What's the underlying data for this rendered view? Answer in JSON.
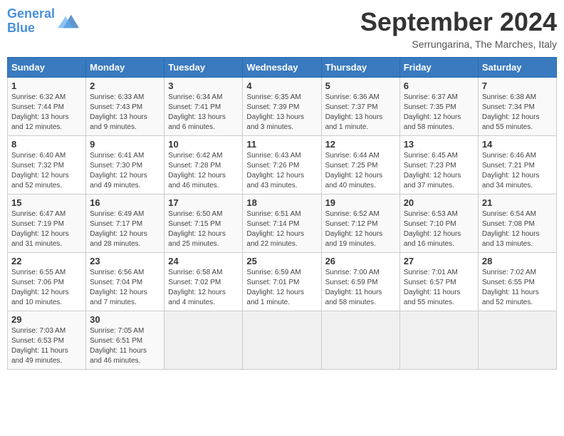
{
  "header": {
    "logo_line1": "General",
    "logo_line2": "Blue",
    "title": "September 2024",
    "location": "Serrungarina, The Marches, Italy"
  },
  "days_of_week": [
    "Sunday",
    "Monday",
    "Tuesday",
    "Wednesday",
    "Thursday",
    "Friday",
    "Saturday"
  ],
  "weeks": [
    [
      {
        "day": "1",
        "sunrise": "6:32 AM",
        "sunset": "7:44 PM",
        "daylight": "13 hours and 12 minutes."
      },
      {
        "day": "2",
        "sunrise": "6:33 AM",
        "sunset": "7:43 PM",
        "daylight": "13 hours and 9 minutes."
      },
      {
        "day": "3",
        "sunrise": "6:34 AM",
        "sunset": "7:41 PM",
        "daylight": "13 hours and 6 minutes."
      },
      {
        "day": "4",
        "sunrise": "6:35 AM",
        "sunset": "7:39 PM",
        "daylight": "13 hours and 3 minutes."
      },
      {
        "day": "5",
        "sunrise": "6:36 AM",
        "sunset": "7:37 PM",
        "daylight": "13 hours and 1 minute."
      },
      {
        "day": "6",
        "sunrise": "6:37 AM",
        "sunset": "7:35 PM",
        "daylight": "12 hours and 58 minutes."
      },
      {
        "day": "7",
        "sunrise": "6:38 AM",
        "sunset": "7:34 PM",
        "daylight": "12 hours and 55 minutes."
      }
    ],
    [
      {
        "day": "8",
        "sunrise": "6:40 AM",
        "sunset": "7:32 PM",
        "daylight": "12 hours and 52 minutes."
      },
      {
        "day": "9",
        "sunrise": "6:41 AM",
        "sunset": "7:30 PM",
        "daylight": "12 hours and 49 minutes."
      },
      {
        "day": "10",
        "sunrise": "6:42 AM",
        "sunset": "7:28 PM",
        "daylight": "12 hours and 46 minutes."
      },
      {
        "day": "11",
        "sunrise": "6:43 AM",
        "sunset": "7:26 PM",
        "daylight": "12 hours and 43 minutes."
      },
      {
        "day": "12",
        "sunrise": "6:44 AM",
        "sunset": "7:25 PM",
        "daylight": "12 hours and 40 minutes."
      },
      {
        "day": "13",
        "sunrise": "6:45 AM",
        "sunset": "7:23 PM",
        "daylight": "12 hours and 37 minutes."
      },
      {
        "day": "14",
        "sunrise": "6:46 AM",
        "sunset": "7:21 PM",
        "daylight": "12 hours and 34 minutes."
      }
    ],
    [
      {
        "day": "15",
        "sunrise": "6:47 AM",
        "sunset": "7:19 PM",
        "daylight": "12 hours and 31 minutes."
      },
      {
        "day": "16",
        "sunrise": "6:49 AM",
        "sunset": "7:17 PM",
        "daylight": "12 hours and 28 minutes."
      },
      {
        "day": "17",
        "sunrise": "6:50 AM",
        "sunset": "7:15 PM",
        "daylight": "12 hours and 25 minutes."
      },
      {
        "day": "18",
        "sunrise": "6:51 AM",
        "sunset": "7:14 PM",
        "daylight": "12 hours and 22 minutes."
      },
      {
        "day": "19",
        "sunrise": "6:52 AM",
        "sunset": "7:12 PM",
        "daylight": "12 hours and 19 minutes."
      },
      {
        "day": "20",
        "sunrise": "6:53 AM",
        "sunset": "7:10 PM",
        "daylight": "12 hours and 16 minutes."
      },
      {
        "day": "21",
        "sunrise": "6:54 AM",
        "sunset": "7:08 PM",
        "daylight": "12 hours and 13 minutes."
      }
    ],
    [
      {
        "day": "22",
        "sunrise": "6:55 AM",
        "sunset": "7:06 PM",
        "daylight": "12 hours and 10 minutes."
      },
      {
        "day": "23",
        "sunrise": "6:56 AM",
        "sunset": "7:04 PM",
        "daylight": "12 hours and 7 minutes."
      },
      {
        "day": "24",
        "sunrise": "6:58 AM",
        "sunset": "7:02 PM",
        "daylight": "12 hours and 4 minutes."
      },
      {
        "day": "25",
        "sunrise": "6:59 AM",
        "sunset": "7:01 PM",
        "daylight": "12 hours and 1 minute."
      },
      {
        "day": "26",
        "sunrise": "7:00 AM",
        "sunset": "6:59 PM",
        "daylight": "11 hours and 58 minutes."
      },
      {
        "day": "27",
        "sunrise": "7:01 AM",
        "sunset": "6:57 PM",
        "daylight": "11 hours and 55 minutes."
      },
      {
        "day": "28",
        "sunrise": "7:02 AM",
        "sunset": "6:55 PM",
        "daylight": "11 hours and 52 minutes."
      }
    ],
    [
      {
        "day": "29",
        "sunrise": "7:03 AM",
        "sunset": "6:53 PM",
        "daylight": "11 hours and 49 minutes."
      },
      {
        "day": "30",
        "sunrise": "7:05 AM",
        "sunset": "6:51 PM",
        "daylight": "11 hours and 46 minutes."
      },
      null,
      null,
      null,
      null,
      null
    ]
  ]
}
